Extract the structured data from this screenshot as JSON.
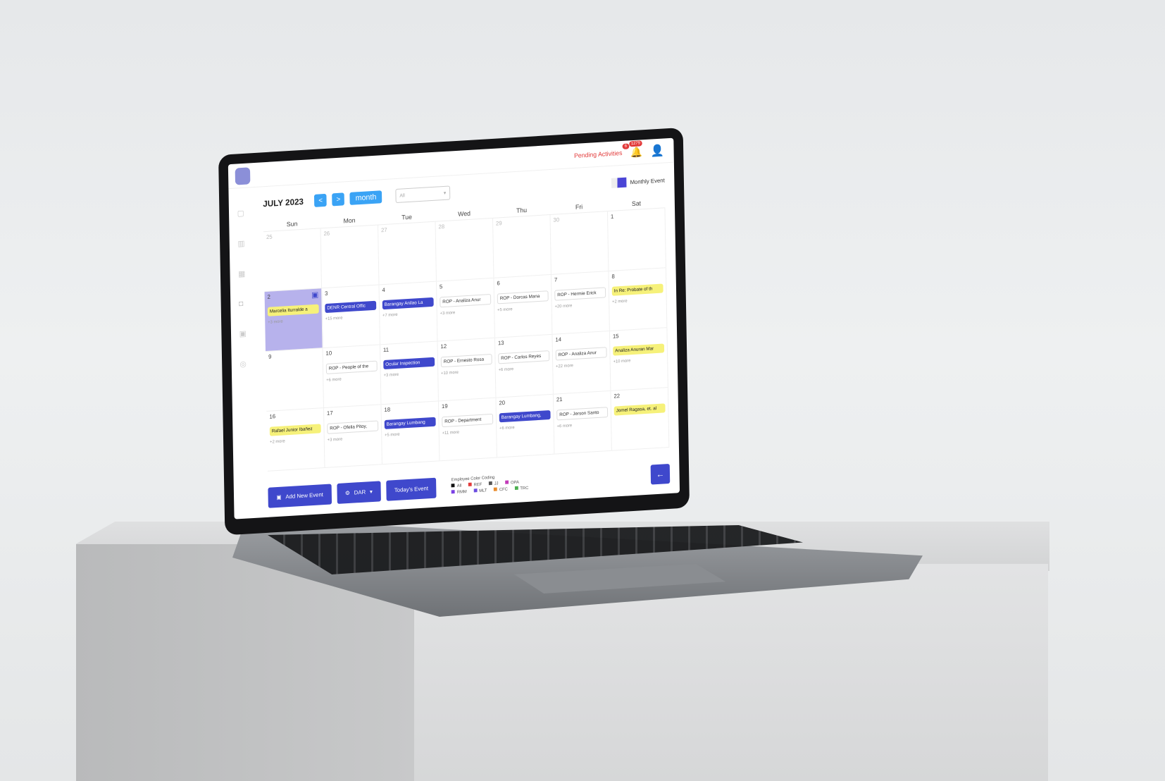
{
  "topbar": {
    "pending_label": "Pending Activities",
    "pending_count": "6",
    "notif_count": "1279"
  },
  "toolbar": {
    "month_title": "JULY 2023",
    "prev": "<",
    "next": ">",
    "view_label": "month",
    "select_value": "All",
    "legend_label": "Monthly Event"
  },
  "calendar": {
    "days": [
      "Sun",
      "Mon",
      "Tue",
      "Wed",
      "Thu",
      "Fri",
      "Sat"
    ],
    "weeks": [
      [
        {
          "n": "25",
          "muted": true
        },
        {
          "n": "26",
          "muted": true
        },
        {
          "n": "27",
          "muted": true
        },
        {
          "n": "28",
          "muted": true
        },
        {
          "n": "29",
          "muted": true
        },
        {
          "n": "30",
          "muted": true
        },
        {
          "n": "1"
        }
      ],
      [
        {
          "n": "2",
          "ev": "Marcelia Iturralde a",
          "c": "yellow",
          "more": "+3 more",
          "today": true
        },
        {
          "n": "3",
          "ev": "DENR Central Offic",
          "c": "blue",
          "more": "+15 more"
        },
        {
          "n": "4",
          "ev": "Barangay Anilao La",
          "c": "blue",
          "more": "+7 more"
        },
        {
          "n": "5",
          "ev": "ROP - Analiza Anur",
          "c": "white",
          "more": "+3 more"
        },
        {
          "n": "6",
          "ev": "ROP - Dorcas Mana",
          "c": "white",
          "more": "+5 more"
        },
        {
          "n": "7",
          "ev": "ROP - Hermie Erick",
          "c": "white",
          "more": "+20 more"
        },
        {
          "n": "8",
          "ev": "In Re: Probate of th",
          "c": "yellow",
          "more": "+2 more"
        }
      ],
      [
        {
          "n": "9"
        },
        {
          "n": "10",
          "ev": "ROP - People of the",
          "c": "white",
          "more": "+6 more"
        },
        {
          "n": "11",
          "ev": "Ocular Inspection",
          "c": "blue",
          "more": "+3 more"
        },
        {
          "n": "12",
          "ev": "ROP - Ernesto Rosa",
          "c": "white",
          "more": "+10 more"
        },
        {
          "n": "13",
          "ev": "ROP - Carlos Reyes",
          "c": "white",
          "more": "+6 more"
        },
        {
          "n": "14",
          "ev": "ROP - Analiza Anur",
          "c": "white",
          "more": "+22 more"
        },
        {
          "n": "15",
          "ev": "Analiza Anuran Mar",
          "c": "yellow",
          "more": "+10 more"
        }
      ],
      [
        {
          "n": "16",
          "ev": "Rafael Junior Ibañez",
          "c": "yellow",
          "more": "+2 more"
        },
        {
          "n": "17",
          "ev": "ROP - Ofelia Pitoy,",
          "c": "white",
          "more": "+3 more"
        },
        {
          "n": "18",
          "ev": "Barangay Lumbang",
          "c": "blue",
          "more": "+5 more"
        },
        {
          "n": "19",
          "ev": "ROP - Department",
          "c": "white",
          "more": "+11 more"
        },
        {
          "n": "20",
          "ev": "Barangay Lumbang,",
          "c": "blue",
          "more": "+6 more"
        },
        {
          "n": "21",
          "ev": "ROP - Jerson Santo",
          "c": "white",
          "more": "+6 more"
        },
        {
          "n": "22",
          "ev": "Jomel Ragasa, et. al",
          "c": "yellow",
          "more": ""
        }
      ]
    ]
  },
  "bottom": {
    "add_label": "Add New Event",
    "dar_label": "DAR",
    "today_label": "Today's Event",
    "coding_title": "Employee Color Coding",
    "coding_row1": [
      "All",
      "REF",
      "JJ",
      "OPA"
    ],
    "coding_row2": [
      "RMM",
      "MLT",
      "CFC",
      "TRC"
    ]
  },
  "colors": {
    "accent": "#3f48cc",
    "yellow": "#f6f17a",
    "today": "#b7b2ec",
    "alert": "#e23a3a"
  }
}
